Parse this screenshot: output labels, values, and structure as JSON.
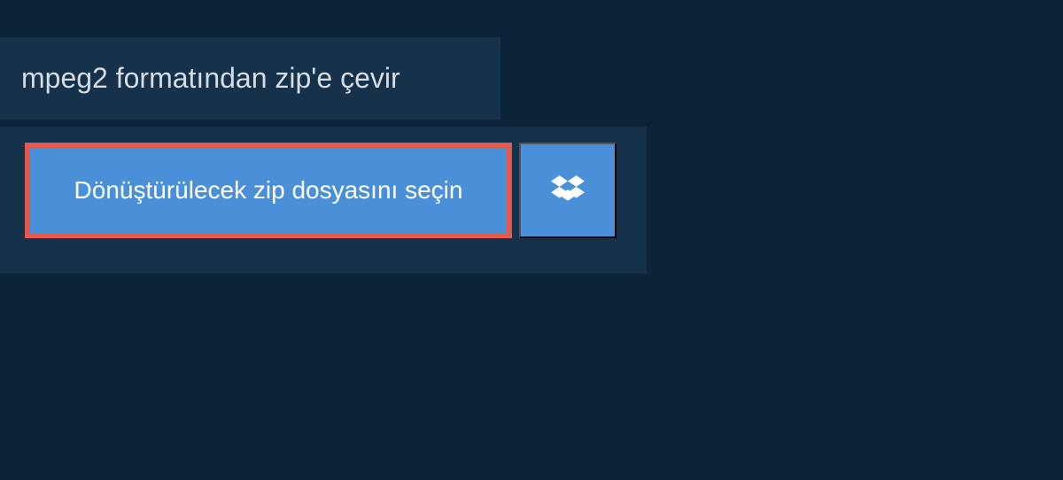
{
  "header": {
    "title": "mpeg2 formatından zip'e çevir"
  },
  "main": {
    "select_file_button_label": "Dönüştürülecek zip dosyasını seçin"
  }
}
